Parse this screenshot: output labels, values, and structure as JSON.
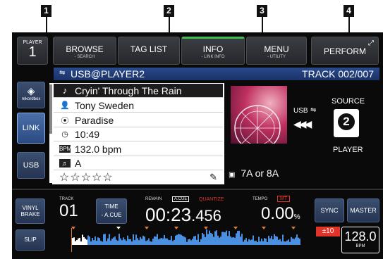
{
  "callouts": [
    "1",
    "2",
    "3",
    "4"
  ],
  "player": {
    "label": "PLAYER",
    "number": "1"
  },
  "top_buttons": [
    {
      "main": "BROWSE",
      "sub": "- SEARCH"
    },
    {
      "main": "TAG LIST",
      "sub": ""
    },
    {
      "main": "INFO",
      "sub": "- LINK INFO"
    },
    {
      "main": "MENU",
      "sub": "- UTILITY"
    },
    {
      "main": "PERFORM",
      "sub": ""
    }
  ],
  "source_bar": {
    "source": "USB@PLAYER2",
    "track_label": "TRACK 002/007"
  },
  "side_buttons": {
    "rekordbox": "rekordbox",
    "link": "LINK",
    "usb": "USB"
  },
  "track_info": {
    "title": "Cryin' Through The Rain",
    "artist": "Tony Sweden",
    "album": "Paradise",
    "time": "10:49",
    "bpm": "132.0 bpm",
    "key": "A",
    "rating": "☆☆☆☆☆"
  },
  "source_panel": {
    "usb": "USB",
    "arrows": "◀◀◀",
    "label": "SOURCE",
    "player_number": "2",
    "player_label": "PLAYER"
  },
  "key_compat": "7A or 8A",
  "bottom": {
    "vinyl_brake": [
      "VINYL",
      "BRAKE"
    ],
    "slip": "SLIP",
    "track_label": "TRACK",
    "track_number": "01",
    "time_mode": [
      "TIME",
      "- A.CUE"
    ],
    "remain_label": "REMAIN",
    "acue_label": "A.CUE",
    "quantize_label": "QUANTIZE",
    "time_main": "00:23",
    "time_fraction": ".456",
    "tempo_label": "TEMPO",
    "mt_label": "MT",
    "tempo_value": "0.00",
    "tempo_unit": "%",
    "sync": "SYNC",
    "master": "MASTER",
    "range": "±10",
    "bpm_value": "128.0",
    "bpm_unit": "BPM"
  },
  "colors": {
    "accent_green": "#3fbf4f",
    "quantize_red": "#e0342a",
    "waveform_blue": "#4a8fe0"
  }
}
